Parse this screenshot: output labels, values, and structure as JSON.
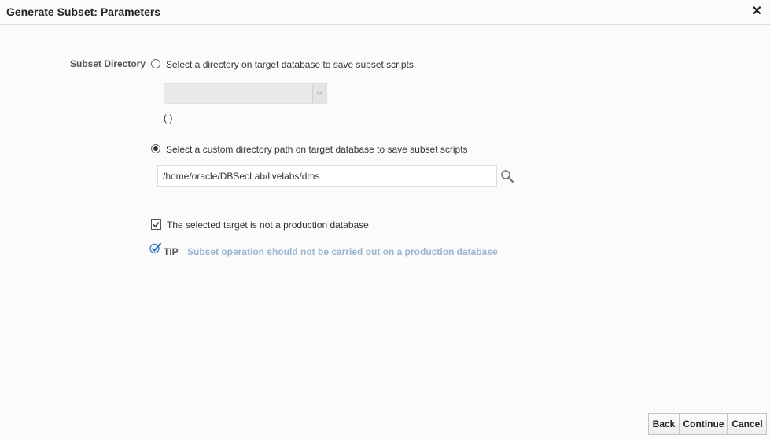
{
  "dialog": {
    "title": "Generate Subset: Parameters",
    "close_glyph": "✕"
  },
  "subset_directory": {
    "label": "Subset Directory",
    "option_directory": {
      "label": "Select a directory on target database to save subset scripts",
      "selected": false,
      "select_value": "",
      "note": "( )"
    },
    "option_custom_path": {
      "label": "Select a custom directory path on target database to save subset scripts",
      "selected": true,
      "path_value": "/home/oracle/DBSecLab/livelabs/dms",
      "search_icon": "search-icon"
    }
  },
  "production_check": {
    "label": "The selected target is not a production database",
    "checked": true
  },
  "tip": {
    "label": "TIP",
    "text": "Subset operation should not be carried out on a production database",
    "icon": "check-tip-icon",
    "text_color": "#9bb5d0"
  },
  "footer": {
    "back_label": "Back",
    "continue_label": "Continue",
    "cancel_label": "Cancel"
  }
}
